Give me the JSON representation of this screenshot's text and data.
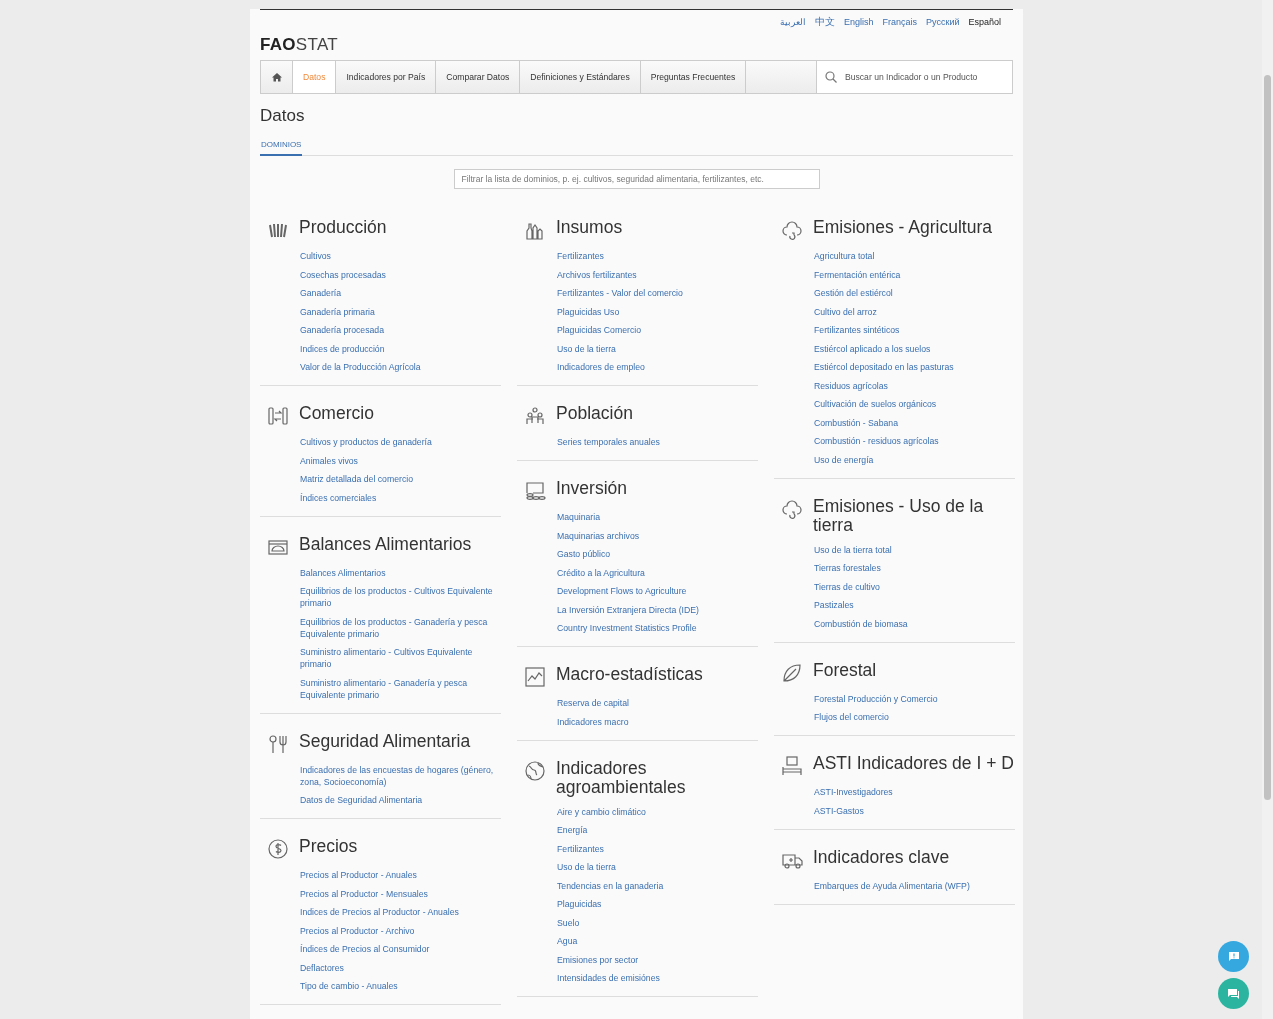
{
  "languages": [
    {
      "label": "العربية",
      "selected": false
    },
    {
      "label": "中文",
      "selected": false
    },
    {
      "label": "English",
      "selected": false
    },
    {
      "label": "Français",
      "selected": false
    },
    {
      "label": "Русский",
      "selected": false
    },
    {
      "label": "Español",
      "selected": true
    }
  ],
  "logo": {
    "strong": "FAO",
    "light": "STAT"
  },
  "nav": {
    "items": [
      {
        "label": "Datos",
        "selected": true
      },
      {
        "label": "Indicadores por País",
        "selected": false
      },
      {
        "label": "Comparar Datos",
        "selected": false
      },
      {
        "label": "Definiciones y Estándares",
        "selected": false
      },
      {
        "label": "Preguntas Frecuentes",
        "selected": false
      }
    ],
    "search_placeholder": "Buscar un Indicador o un Producto"
  },
  "page_title": "Datos",
  "tabs": [
    {
      "label": "DOMINIOS",
      "selected": true
    }
  ],
  "filter": {
    "placeholder": "Filtrar la lista de dominios, p. ej. cultivos, seguridad alimentaria, fertilizantes, etc."
  },
  "columns": [
    [
      {
        "kind": "wheat",
        "title": "Producción",
        "links": [
          "Cultivos",
          "Cosechas procesadas",
          "Ganadería",
          "Ganadería primaria",
          "Ganadería procesada",
          "Indices de producción",
          "Valor de la Producción Agrícola"
        ]
      },
      {
        "kind": "trade",
        "title": "Comercio",
        "links": [
          "Cultivos y productos de ganadería",
          "Animales vivos",
          "Matriz detallada del comercio",
          "Índices comerciales"
        ]
      },
      {
        "kind": "scale",
        "title": "Balances Alimentarios",
        "links": [
          "Balances Alimentarios",
          "Equilibrios de los productos - Cultivos Equivalente primario",
          "Equilibrios de los productos - Ganadería y pesca Equivalente primario",
          "Suministro alimentario - Cultivos Equivalente primario",
          "Suministro alimentario - Ganadería y pesca Equivalente primario"
        ]
      },
      {
        "kind": "cutlery",
        "title": "Seguridad Alimentaria",
        "links": [
          "Indicadores de las encuestas de hogares (género, zona, Socioeconomía)",
          "Datos de Seguridad Alimentaria"
        ]
      },
      {
        "kind": "dollar",
        "title": "Precios",
        "links": [
          "Precios al Productor - Anuales",
          "Precios al Productor - Mensuales",
          "Indices de Precios al Productor - Anuales",
          "Precios al Productor - Archivo",
          "Índices de Precios al Consumidor",
          "Deflactores",
          "Tipo de cambio - Anuales"
        ]
      }
    ],
    [
      {
        "kind": "bottles",
        "title": "Insumos",
        "links": [
          "Fertilizantes",
          "Archivos fertilizantes",
          "Fertilizantes - Valor del comercio",
          "Plaguicidas Uso",
          "Plaguicidas Comercio",
          "Uso de la tierra",
          "Indicadores de empleo"
        ]
      },
      {
        "kind": "people",
        "title": "Población",
        "links": [
          "Series temporales anuales"
        ]
      },
      {
        "kind": "coins",
        "title": "Inversión",
        "links": [
          "Maquinaria",
          "Maquinarias archivos",
          "Gasto público",
          "Crédito a la Agricultura",
          "Development Flows to Agriculture",
          "La Inversión Extranjera Directa (IDE)",
          "Country Investment Statistics Profile"
        ]
      },
      {
        "kind": "chart",
        "title": "Macro-estadísticas",
        "links": [
          "Reserva de capital",
          "Indicadores macro"
        ]
      },
      {
        "kind": "globe",
        "title": "Indicadores agroambientales",
        "links": [
          "Aire y cambio climático",
          "Energía",
          "Fertilizantes",
          "Uso de la tierra",
          "Tendencias en la ganaderia",
          "Plaguicidas",
          "Suelo",
          "Agua",
          "Emisiones por sector",
          "Intensidades de emisiónes"
        ]
      }
    ],
    [
      {
        "kind": "cloud",
        "title": "Emisiones - Agricultura",
        "links": [
          "Agricultura total",
          "Fermentación entérica",
          "Gestión del estiércol",
          "Cultivo del arroz",
          "Fertilizantes sintéticos",
          "Estiércol aplicado a los suelos",
          "Estiércol depositado en las pasturas",
          "Residuos agrícolas",
          "Cultivación de suelos orgánicos",
          "Combustión - Sabana",
          "Combustión - residuos agrícolas",
          "Uso de energía"
        ]
      },
      {
        "kind": "cloud",
        "title": "Emisiones - Uso de la tierra",
        "links": [
          "Uso de la tierra total",
          "Tierras forestales",
          "Tierras de cultivo",
          "Pastizales",
          "Combustión de biomasa"
        ]
      },
      {
        "kind": "leaf",
        "title": "Forestal",
        "links": [
          "Forestal Producción y Comercio",
          "Flujos del comercio"
        ]
      },
      {
        "kind": "desk",
        "title": "ASTI Indicadores de I + D",
        "links": [
          "ASTI-Investigadores",
          "ASTI-Gastos"
        ]
      },
      {
        "kind": "truck",
        "title": "Indicadores clave",
        "links": [
          "Embarques de Ayuda Alimentaria (WFP)"
        ]
      }
    ]
  ]
}
